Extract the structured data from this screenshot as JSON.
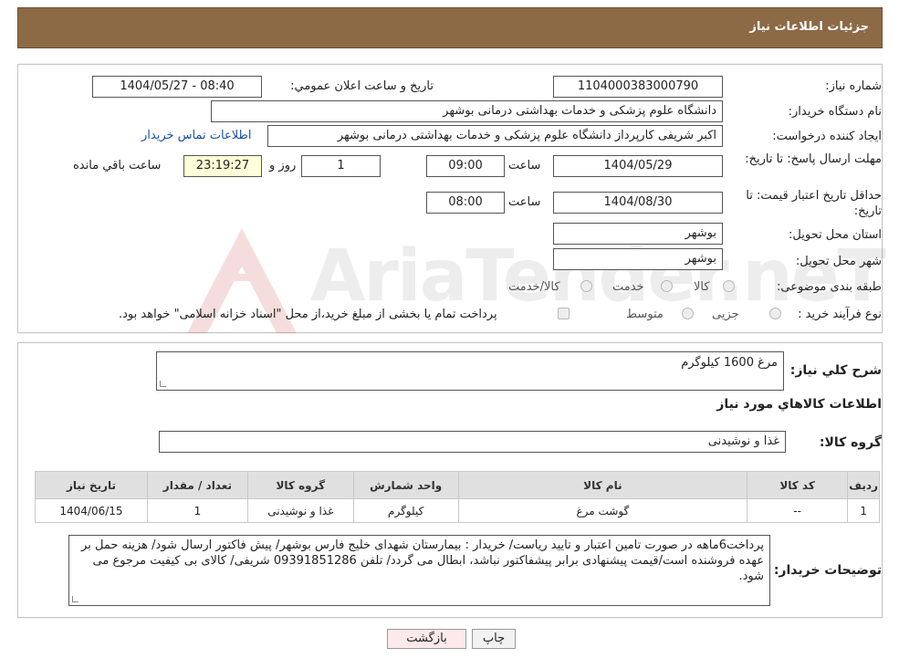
{
  "header": {
    "title": "جزئیات اطلاعات نیاز"
  },
  "details": {
    "need_number_label": "شماره نیاز:",
    "need_number": "1104000383000790",
    "announce_label": "تاریخ و ساعت اعلان عمومي:",
    "announce_value": "1404/05/27 - 08:40",
    "buyer_org_label": "نام دستگاه خریدار:",
    "buyer_org": "دانشگاه علوم پزشکی و خدمات بهداشتی درمانی بوشهر",
    "creator_label": "ایجاد کننده درخواست:",
    "creator": "اکبر شریفی کارپرداز دانشگاه علوم پزشکی و خدمات بهداشتی درمانی بوشهر",
    "contact_link": "اطلاعات تماس خریدار",
    "deadline_label": "مهلت ارسال پاسخ: تا تاریخ:",
    "deadline_date": "1404/05/29",
    "time_label": "ساعت",
    "deadline_time": "09:00",
    "days": "1",
    "days_label": "روز و",
    "remaining": "23:19:27",
    "remaining_label": "ساعت باقي مانده",
    "validity_label": "حداقل تاریخ اعتبار قیمت: تا تاریخ:",
    "validity_date": "1404/08/30",
    "validity_time": "08:00",
    "province_label": "استان محل تحویل:",
    "province": "بوشهر",
    "city_label": "شهر محل تحویل:",
    "city": "بوشهر",
    "category_label": "طبقه بندی موضوعی:",
    "category_options": [
      "کالا",
      "خدمت",
      "کالا/خدمت"
    ],
    "process_label": "نوع فرآیند خرید :",
    "process_options": [
      "جزیی",
      "متوسط"
    ],
    "process_note": "پرداخت تمام یا بخشی از مبلغ خرید،از محل \"اسناد خزانه اسلامی\" خواهد بود."
  },
  "summary": {
    "desc_label": "شرح کلي نیاز:",
    "desc_value": "مرغ 1600 کیلوگرم",
    "goods_info_title": "اطلاعات کالاهاي مورد نیاز",
    "group_label": "گروه کالا:",
    "group_value": "غذا و نوشیدنی",
    "table": {
      "headers": [
        "ردیف",
        "کد کالا",
        "نام کالا",
        "واحد شمارش",
        "گروه کالا",
        "تعداد / مقدار",
        "تاریخ نیاز"
      ],
      "rows": [
        [
          "1",
          "--",
          "گوشت مرغ",
          "کیلوگرم",
          "غذا و نوشیدنی",
          "1",
          "1404/06/15"
        ]
      ]
    },
    "notes_label": "توضیحات خریدار:",
    "notes_value": "پرداخت6ماهه در صورت تامین اعتبار و تایید ریاست/ خریدار : بیمارستان شهدای خلیج فارس بوشهر/ پیش فاکتور ارسال شود/ هزینه حمل بر عهده فروشنده است/قیمت پیشنهادی برابر پیشفاکتور نباشد، ابطال می گردد/ تلفن 09391851286 شریفی/ کالای بی کیفیت مرجوع می شود."
  },
  "buttons": {
    "print": "چاپ",
    "back": "بازگشت"
  },
  "watermark": {
    "text": "AriaTender.neT"
  },
  "colors": {
    "header_bg": "#8d6a46",
    "remaining_bg": "#ffffd8",
    "link": "#1a4fa6",
    "back_btn_bg": "#fde9e9"
  }
}
